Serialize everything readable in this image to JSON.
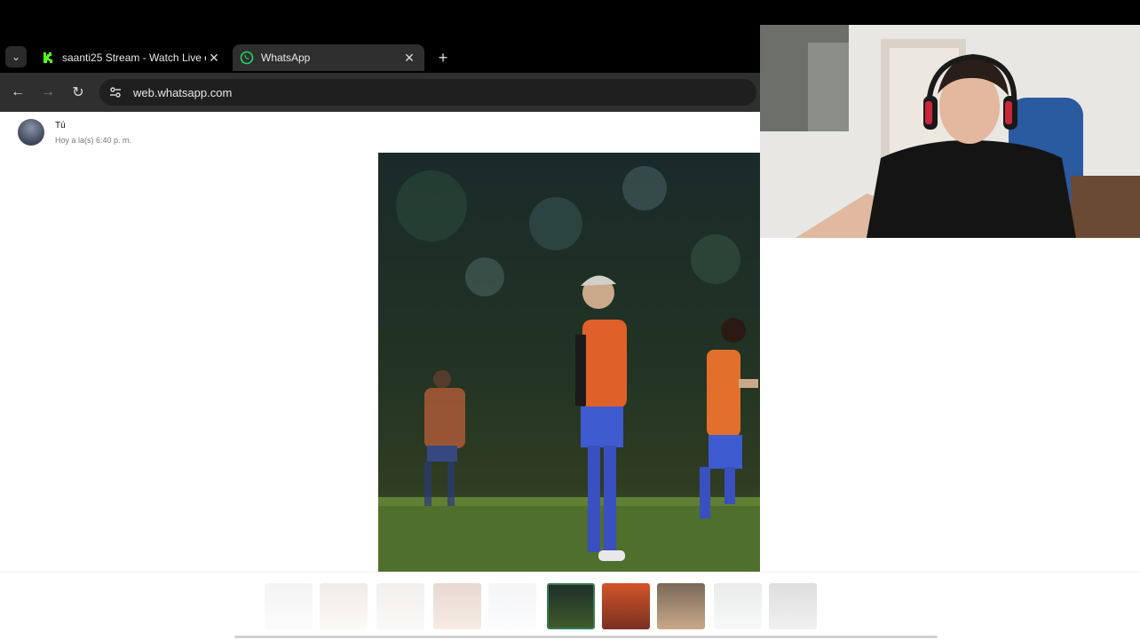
{
  "browser": {
    "tabs": [
      {
        "title": "saanti25 Stream - Watch Live o",
        "active": false,
        "favicon": "kick-icon"
      },
      {
        "title": "WhatsApp",
        "active": true,
        "favicon": "whatsapp-icon"
      }
    ],
    "url": "web.whatsapp.com"
  },
  "viewer": {
    "sender_name": "Tú",
    "sent_time": "Hoy a la(s) 6:40 p. m."
  },
  "colors": {
    "kick_green": "#53fc18",
    "whatsapp_green": "#25d366",
    "active_thumb_border": "#3a7a52"
  }
}
